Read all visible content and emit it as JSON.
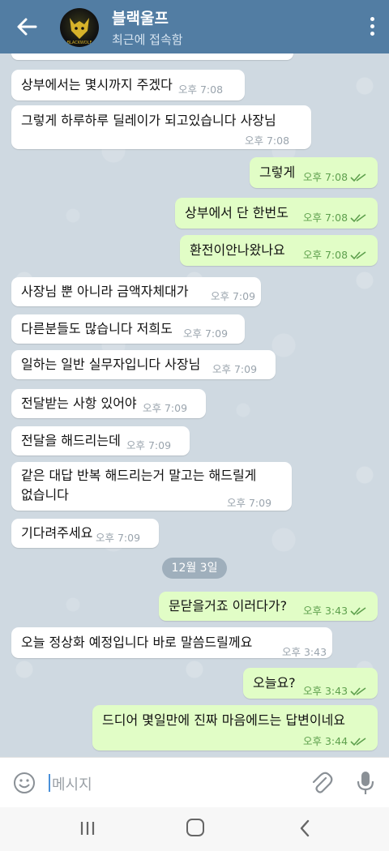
{
  "header": {
    "title": "블랙울프",
    "subtitle": "최근에 접속함",
    "avatar_text": "BLACKWOLF"
  },
  "messages": [
    {
      "dir": "in",
      "text": "상부에서는 몇시까지 주겠다",
      "time": "오후 7:08"
    },
    {
      "dir": "in",
      "text": "그렇게 하루하루 딜레이가 되고있습니다 사장님",
      "time": "오후 7:08"
    },
    {
      "dir": "out",
      "text": "그렇게",
      "time": "오후 7:08"
    },
    {
      "dir": "out",
      "text": "상부에서 단 한번도",
      "time": "오후 7:08"
    },
    {
      "dir": "out",
      "text": "환전이안나왔나요",
      "time": "오후 7:08"
    },
    {
      "dir": "in",
      "text": "사장님 뿐 아니라 금액자체대가",
      "time": "오후 7:09"
    },
    {
      "dir": "in",
      "text": "다른분들도 많습니다 저희도",
      "time": "오후 7:09"
    },
    {
      "dir": "in",
      "text": "일하는 일반 실무자입니다 사장님",
      "time": "오후 7:09"
    },
    {
      "dir": "in",
      "text": "전달받는 사항 있어야",
      "time": "오후 7:09"
    },
    {
      "dir": "in",
      "text": "전달을 해드리는데",
      "time": "오후 7:09"
    },
    {
      "dir": "in",
      "text": "같은 대답 반복 해드리는거 말고는 해드릴게",
      "text2": "없습니다",
      "time": "오후 7:09"
    },
    {
      "dir": "in",
      "text": "기다려주세요",
      "time": "오후 7:09"
    },
    {
      "dir": "out",
      "text": "문닫을거죠 이러다가?",
      "time": "오후 3:43"
    },
    {
      "dir": "in",
      "text": "오늘 정상화 예정입니다 바로 말씀드릴께요",
      "time": "오후 3:43"
    },
    {
      "dir": "out",
      "text": "오늘요?",
      "time": "오후 3:43"
    },
    {
      "dir": "out",
      "text": "드디어 몇일만에 진짜 마음에드는 답변이네요",
      "time": "오후 3:44"
    }
  ],
  "date_divider": "12월 3일",
  "input": {
    "placeholder": "메시지"
  },
  "colors": {
    "header": "#527da3",
    "incoming_bubble": "#ffffff",
    "outgoing_bubble": "#e1fdc6",
    "outgoing_time": "#5ea04d",
    "chat_background": "#cfd9e1"
  },
  "icons": [
    "back-arrow-icon",
    "more-vert-icon",
    "emoji-icon",
    "paperclip-icon",
    "microphone-icon",
    "double-check-icon",
    "nav-recent-icon",
    "nav-home-icon",
    "nav-back-icon"
  ]
}
